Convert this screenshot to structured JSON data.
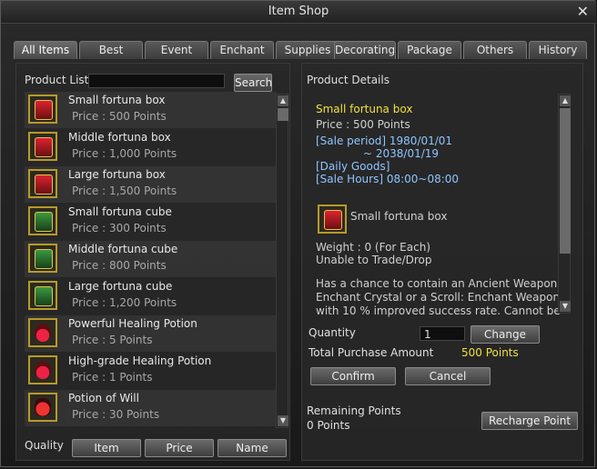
{
  "window": {
    "title": "Item Shop"
  },
  "tabs": [
    {
      "label": "All Items"
    },
    {
      "label": "Best"
    },
    {
      "label": "Event"
    },
    {
      "label": "Enchant"
    },
    {
      "label": "Supplies"
    },
    {
      "label": "Decorating"
    },
    {
      "label": "Package"
    },
    {
      "label": "Others"
    },
    {
      "label": "History"
    }
  ],
  "product_list": {
    "label": "Product List",
    "search_value": "",
    "search_button": "Search",
    "items": [
      {
        "name": "Small fortuna box",
        "price": "Price : 500 Points",
        "icon": "fortuna-box-icon"
      },
      {
        "name": "Middle fortuna box",
        "price": "Price : 1,000 Points",
        "icon": "fortuna-box-icon"
      },
      {
        "name": "Large fortuna box",
        "price": "Price : 1,500 Points",
        "icon": "fortuna-box-icon"
      },
      {
        "name": "Small fortuna cube",
        "price": "Price : 300 Points",
        "icon": "fortuna-cube-icon"
      },
      {
        "name": "Middle fortuna cube",
        "price": "Price : 800 Points",
        "icon": "fortuna-cube-icon"
      },
      {
        "name": "Large fortuna cube",
        "price": "Price : 1,200 Points",
        "icon": "fortuna-cube-icon"
      },
      {
        "name": "Powerful Healing Potion",
        "price": "Price : 5 Points",
        "icon": "healing-potion-icon"
      },
      {
        "name": "High-grade Healing Potion",
        "price": "Price : 1 Points",
        "icon": "healing-potion-icon"
      },
      {
        "name": "Potion of Will",
        "price": "Price : 30 Points",
        "icon": "potion-of-will-icon"
      }
    ],
    "quality_label": "Quality",
    "sort_buttons": [
      "Item",
      "Price",
      "Name"
    ]
  },
  "details": {
    "label": "Product Details",
    "name": "Small fortuna box",
    "price": "Price : 500 Points",
    "sale_period_1": "[Sale period] 1980/01/01",
    "sale_period_2": "~ 2038/01/19",
    "daily": "[Daily Goods]",
    "sale_hours": "[Sale Hours] 08:00~08:00",
    "item_name": "Small fortuna box",
    "weight": "Weight : 0 (For Each)",
    "trade": "Unable to Trade/Drop",
    "desc_1": "Has a chance to contain an Ancient Weapon",
    "desc_2": "Enchant Crystal or a Scroll: Enchant Weapon",
    "desc_3": "with 10 % improved success rate. Cannot be"
  },
  "purchase": {
    "quantity_label": "Quantity",
    "quantity_value": "1",
    "change_button": "Change",
    "total_label": "Total Purchase Amount",
    "total_value": "500 Points",
    "confirm_button": "Confirm",
    "cancel_button": "Cancel",
    "remaining_label": "Remaining Points",
    "remaining_value": "0 Points",
    "recharge_button": "Recharge Point"
  },
  "colors": {
    "highlight_yellow": "#f0e040",
    "icon_border": "#b79a2a"
  }
}
